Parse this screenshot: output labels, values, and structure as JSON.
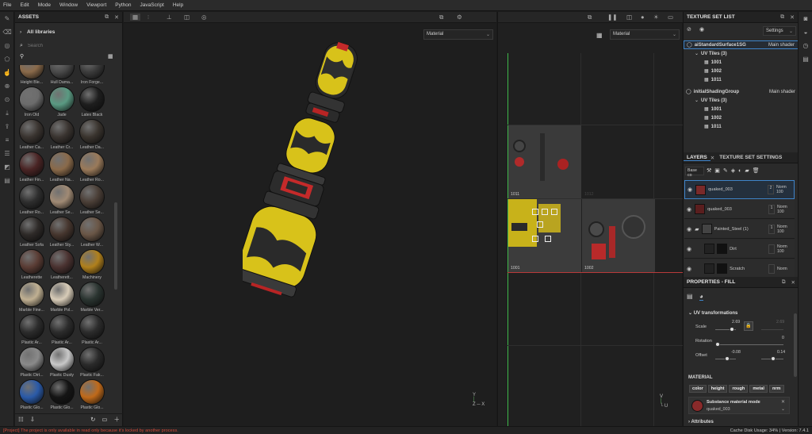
{
  "menu": [
    "File",
    "Edit",
    "Mode",
    "Window",
    "Viewport",
    "Python",
    "JavaScript",
    "Help"
  ],
  "assets": {
    "title": "ASSETS",
    "breadcrumb": "All libraries",
    "search_placeholder": "Search",
    "items": [
      {
        "label": "Height Ble...",
        "color": "#8a6a4a"
      },
      {
        "label": "Hull Dama...",
        "color": "#4a4a4a"
      },
      {
        "label": "Iron Forge...",
        "color": "#3c3c3c"
      },
      {
        "label": "Iron Old",
        "color": "#6c6c6c"
      },
      {
        "label": "Jade",
        "color": "#5a9a82"
      },
      {
        "label": "Latex Black",
        "color": "#1e1e1e"
      },
      {
        "label": "Leather Ca...",
        "color": "#3a3430"
      },
      {
        "label": "Leather Cr...",
        "color": "#3a3430"
      },
      {
        "label": "Leather Da...",
        "color": "#3a342e"
      },
      {
        "label": "Leather Fin...",
        "color": "#4a2424"
      },
      {
        "label": "Leather Na...",
        "color": "#8a6a4a"
      },
      {
        "label": "Leather Ro...",
        "color": "#9a7a5a"
      },
      {
        "label": "Leather Ro...",
        "color": "#2e2e2e"
      },
      {
        "label": "Leather Se...",
        "color": "#a08a74"
      },
      {
        "label": "Leather Se...",
        "color": "#4a3e36"
      },
      {
        "label": "Leather Sofa",
        "color": "#2e2a28"
      },
      {
        "label": "Leather Sty...",
        "color": "#46362e"
      },
      {
        "label": "Leather W...",
        "color": "#6a5646"
      },
      {
        "label": "Leatherette",
        "color": "#5a3c34"
      },
      {
        "label": "Leatherett...",
        "color": "#4a3230"
      },
      {
        "label": "Machinery",
        "color": "#b0801c"
      },
      {
        "label": "Marble Fine...",
        "color": "#c0b092"
      },
      {
        "label": "Marble Pol...",
        "color": "#d8ccb8"
      },
      {
        "label": "Marble Ver...",
        "color": "#2a3430"
      },
      {
        "label": "Plastic Ar...",
        "color": "#2c2c2c"
      },
      {
        "label": "Plastic Ar...",
        "color": "#2c2c2c"
      },
      {
        "label": "Plastic Ar...",
        "color": "#2c2c2c"
      },
      {
        "label": "Plastic Dirt...",
        "color": "#8a8a8a"
      },
      {
        "label": "Plastic Dusty",
        "color": "#c8c8c8"
      },
      {
        "label": "Plastic Fak...",
        "color": "#2a2a2a"
      },
      {
        "label": "Plastic Glo...",
        "color": "#2a5aa8"
      },
      {
        "label": "Plastic Glo...",
        "color": "#151515"
      },
      {
        "label": "Plastic Glo...",
        "color": "#c06a1a"
      }
    ]
  },
  "viewport3d": {
    "mode": "Material"
  },
  "viewport2d": {
    "mode": "Material",
    "tiles": [
      "1011",
      "1012",
      "1001",
      "1002"
    ]
  },
  "texture_set_list": {
    "title": "TEXTURE SET LIST",
    "settings_label": "Settings",
    "sets": [
      {
        "name": "aiStandardSurface1SG",
        "shader": "Main shader",
        "uv_label": "UV Tiles (3)",
        "tiles": [
          "1001",
          "1002",
          "1011"
        ]
      },
      {
        "name": "initialShadingGroup",
        "shader": "Main shader",
        "uv_label": "UV Tiles (3)",
        "tiles": [
          "1001",
          "1002",
          "1011"
        ]
      }
    ]
  },
  "layers": {
    "tab_layers": "LAYERS",
    "tab_settings": "TEXTURE SET SETTINGS",
    "channel": "Base co",
    "items": [
      {
        "name": "quaked_003",
        "blend": "Norm",
        "opacity": "100",
        "count": "2",
        "thumb": "#7a2a2a"
      },
      {
        "name": "quaked_003",
        "blend": "Norm",
        "opacity": "100",
        "count": "1",
        "thumb": "#5a1e1e"
      },
      {
        "name": "Painted_Steel (1)",
        "blend": "Norm",
        "opacity": "100",
        "count": "1",
        "thumb": "#444444"
      },
      {
        "name": "Dirt",
        "blend": "Norm",
        "opacity": "100",
        "count": "",
        "thumb": "#222222"
      },
      {
        "name": "Scratch",
        "blend": "Norm",
        "opacity": "",
        "count": "",
        "thumb": "#222222"
      }
    ]
  },
  "properties": {
    "title": "PROPERTIES - FILL",
    "uv_section": "UV transformations",
    "scale_label": "Scale",
    "scale_value": "2.69",
    "scale_value2": "2.69",
    "rotation_label": "Rotation",
    "rotation_value": "0",
    "offset_label": "Offset",
    "offset_value1": "-0.08",
    "offset_value2": "0.14",
    "material_section": "MATERIAL",
    "chips": [
      "color",
      "height",
      "rough",
      "metal",
      "nrm"
    ],
    "mode_title": "Substance material mode",
    "mode_value": "quaked_003",
    "attributes": "Attributes"
  },
  "status": {
    "warning": "[Project] The project is only available in read only because it's locked by another process.",
    "cache": "Cache Disk Usage: 34% | Version: 7.4.1"
  }
}
